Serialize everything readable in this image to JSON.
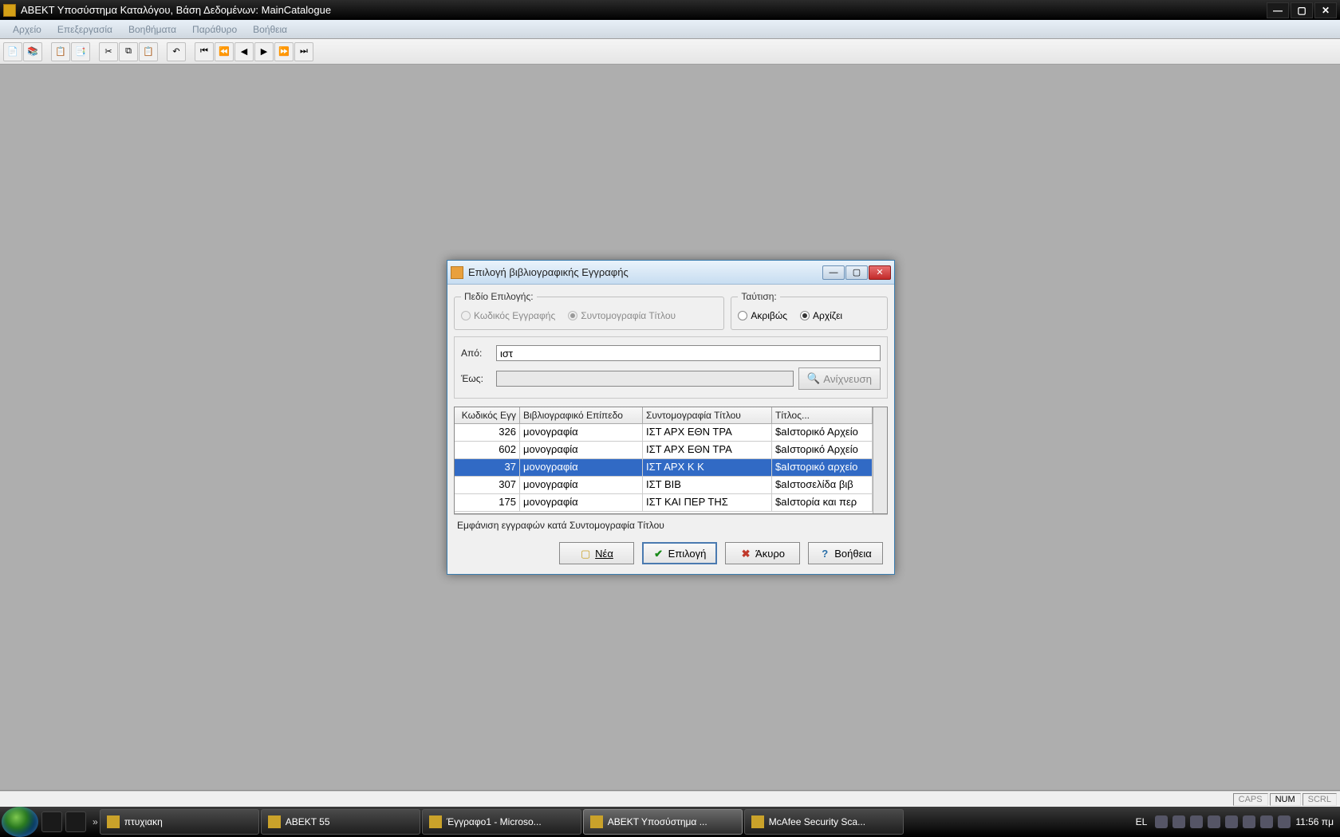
{
  "titlebar": {
    "title": "ΑΒΕΚΤ Υποσύστημα Καταλόγου, Βάση Δεδομένων: MainCatalogue"
  },
  "menu": {
    "file": "Αρχείο",
    "edit": "Επεξεργασία",
    "tools": "Βοηθήματα",
    "window": "Παράθυρο",
    "help": "Βοήθεια"
  },
  "dialog": {
    "title": "Επιλογή βιβλιογραφικής Εγγραφής",
    "fs_field": {
      "legend": "Πεδίο Επιλογής:",
      "opt_code": "Κωδικός Εγγραφής",
      "opt_abbr": "Συντομογραφία Τίτλου"
    },
    "fs_match": {
      "legend": "Ταύτιση:",
      "opt_exact": "Ακριβώς",
      "opt_starts": "Αρχίζει"
    },
    "from_label": "Από:",
    "to_label": "Έως:",
    "from_value": "ιστ",
    "to_value": "",
    "detect": "Ανίχνευση",
    "columns": {
      "c0": "Κωδικός Εγγ",
      "c1": "Βιβλιογραφικό Επίπεδο",
      "c2": "Συντομογραφία Τίτλου",
      "c3": "Τίτλος..."
    },
    "rows": [
      {
        "code": "326",
        "level": "μονογραφία",
        "abbr": "ΙΣΤ ΑΡΧ ΕΘΝ ΤΡΑ",
        "title": "$aΙστορικό Αρχείο"
      },
      {
        "code": "602",
        "level": "μονογραφία",
        "abbr": "ΙΣΤ ΑΡΧ ΕΘΝ ΤΡΑ",
        "title": "$aΙστορικό Αρχείο"
      },
      {
        "code": "37",
        "level": "μονογραφία",
        "abbr": "ΙΣΤ ΑΡΧ Κ Κ",
        "title": "$aΙστορικό αρχείο"
      },
      {
        "code": "307",
        "level": "μονογραφία",
        "abbr": "ΙΣΤ ΒΙΒ",
        "title": "$aΙστοσελίδα βιβ"
      },
      {
        "code": "175",
        "level": "μονογραφία",
        "abbr": "ΙΣΤ ΚΑΙ ΠΕΡ ΤΗΣ",
        "title": "$aΙστορία και περ"
      }
    ],
    "selected_index": 2,
    "status": "Εμφάνιση εγγραφών κατά Συντομογραφία Τίτλου",
    "buttons": {
      "new": "Νέα",
      "select": "Επιλογή",
      "cancel": "Άκυρο",
      "help": "Βοήθεια"
    }
  },
  "statusbar": {
    "caps": "CAPS",
    "num": "NUM",
    "scrl": "SCRL"
  },
  "taskbar": {
    "items": [
      {
        "label": "πτυχιακη"
      },
      {
        "label": "ABEKT 55"
      },
      {
        "label": "Έγγραφο1 - Microso..."
      },
      {
        "label": "ΑΒΕΚΤ Υποσύστημα ..."
      },
      {
        "label": "McAfee Security Sca..."
      }
    ],
    "active_index": 3,
    "lang": "EL",
    "clock": "11:56 πμ"
  }
}
